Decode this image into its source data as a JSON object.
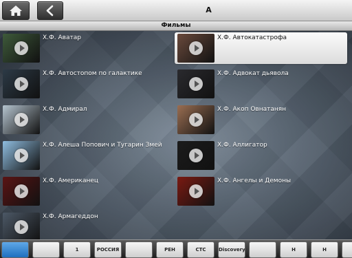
{
  "topbar": {
    "home_icon": "home-icon",
    "back_icon": "chevron-left-icon",
    "title": "А"
  },
  "section": {
    "title": "Фильмы"
  },
  "movies": [
    {
      "title": "Х.Ф. Аватар",
      "thumb_color": "#3e5a3a",
      "selected": false
    },
    {
      "title": "Х.Ф. Автокатастрофа",
      "thumb_color": "#6a4a3c",
      "selected": true
    },
    {
      "title": "Х.Ф. Автостопом по галактике",
      "thumb_color": "#2c3a46",
      "selected": false
    },
    {
      "title": "Х.Ф. Адвокат дьявола",
      "thumb_color": "#2a2a2e",
      "selected": false
    },
    {
      "title": "Х.Ф. Адмирал",
      "thumb_color": "#b5c4cf",
      "selected": false
    },
    {
      "title": "Х.Ф. Акоп Овнатанян",
      "thumb_color": "#9a6e52",
      "selected": false
    },
    {
      "title": "Х.Ф. Алеша Попович и Тугарин Змей",
      "thumb_color": "#8fbde0",
      "selected": false
    },
    {
      "title": "Х.Ф. Аллигатор",
      "thumb_color": "#1b1b1b",
      "selected": false
    },
    {
      "title": "Х.Ф. Американец",
      "thumb_color": "#5a1414",
      "selected": false
    },
    {
      "title": "Х.Ф. Ангелы и Демоны",
      "thumb_color": "#7a1a12",
      "selected": false
    },
    {
      "title": "Х.Ф. Армагеддон",
      "thumb_color": "#4c5866",
      "selected": false
    }
  ],
  "channels": [
    {
      "icon": "movie-clapper-icon",
      "label": "",
      "active": true
    },
    {
      "icon": "film-reel-icon",
      "label": "",
      "active": false
    },
    {
      "icon": "channel-one-icon",
      "label": "1",
      "active": false
    },
    {
      "icon": "russia1-icon",
      "label": "РОССИЯ 1",
      "active": false
    },
    {
      "icon": "perets-icon",
      "label": "",
      "active": false
    },
    {
      "icon": "ren-tv-icon",
      "label": "РЕН",
      "active": false
    },
    {
      "icon": "sts-icon",
      "label": "СТС",
      "active": false
    },
    {
      "icon": "discovery-icon",
      "label": "Discovery",
      "active": false
    },
    {
      "icon": "animal-planet-icon",
      "label": "",
      "active": false
    },
    {
      "icon": "history-icon",
      "label": "H",
      "active": false
    },
    {
      "icon": "nat-geo-icon",
      "label": "H",
      "active": false
    },
    {
      "icon": "extra-channel-icon",
      "label": "",
      "active": false
    }
  ]
}
